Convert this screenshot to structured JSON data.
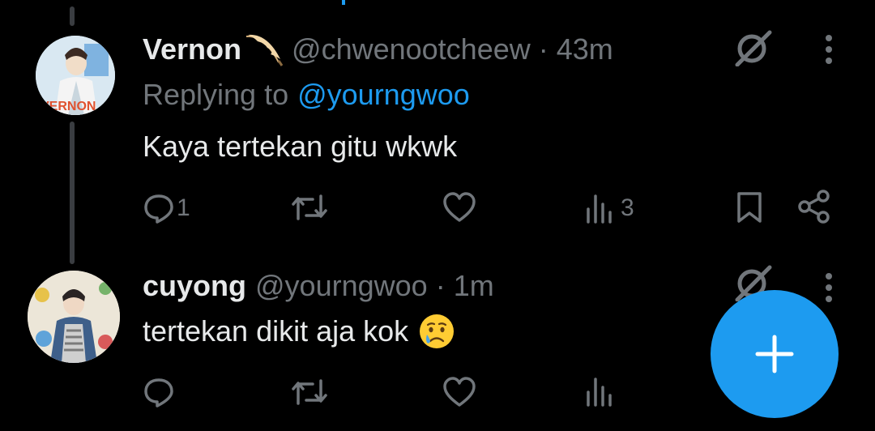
{
  "tweets": [
    {
      "display_name": "Vernon",
      "name_emoji": "feather",
      "handle": "@chwenootcheew",
      "separator": "·",
      "time": "43m",
      "reply_prefix": "Replying to",
      "reply_to": "@yourngwoo",
      "text": "Kaya tertekan gitu wkwk",
      "reply_count": "1",
      "view_count": "3",
      "avatar_text": "VERNON"
    },
    {
      "display_name": "cuyong",
      "handle": "@yourngwoo",
      "separator": "·",
      "time": "1m",
      "text": "tertekan dikit aja kok",
      "text_emoji": "crying-face"
    }
  ],
  "colors": {
    "accent": "#1d9bf0",
    "muted": "#71767b",
    "text": "#e7e9ea",
    "background": "#000000"
  },
  "icons": [
    "grok-icon",
    "more-vertical-icon",
    "reply-icon",
    "retweet-icon",
    "like-icon",
    "views-icon",
    "bookmark-icon",
    "share-icon",
    "plus-icon"
  ]
}
